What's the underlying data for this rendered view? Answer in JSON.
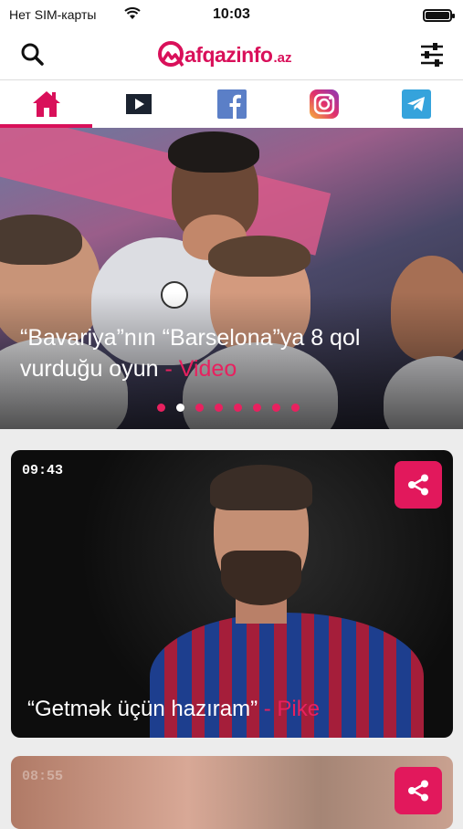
{
  "status_bar": {
    "carrier": "Нет SIM-карты",
    "time": "10:03",
    "battery_level": 1.0
  },
  "header": {
    "logo_word": "afqazinfo",
    "logo_tld": ".az",
    "search_icon": "search-icon",
    "filter_icon": "sliders-icon"
  },
  "tabs": [
    {
      "name": "home",
      "icon": "home-icon",
      "active": true
    },
    {
      "name": "video",
      "icon": "play-icon",
      "active": false
    },
    {
      "name": "facebook",
      "icon": "facebook-icon",
      "active": false
    },
    {
      "name": "instagram",
      "icon": "instagram-icon",
      "active": false
    },
    {
      "name": "telegram",
      "icon": "telegram-icon",
      "active": false
    }
  ],
  "hero": {
    "title": "“Bavariya”nın “Barselona”ya 8 qol vurduğu oyun",
    "tag": "- Video",
    "slide_count": 8,
    "active_slide": 2
  },
  "cards": [
    {
      "time": "09:43",
      "title": "“Getmək üçün hazıram”",
      "tag": "- Pike"
    },
    {
      "time": "08:55"
    }
  ],
  "colors": {
    "accent": "#d9105a",
    "share_bg": "#e2185c"
  }
}
